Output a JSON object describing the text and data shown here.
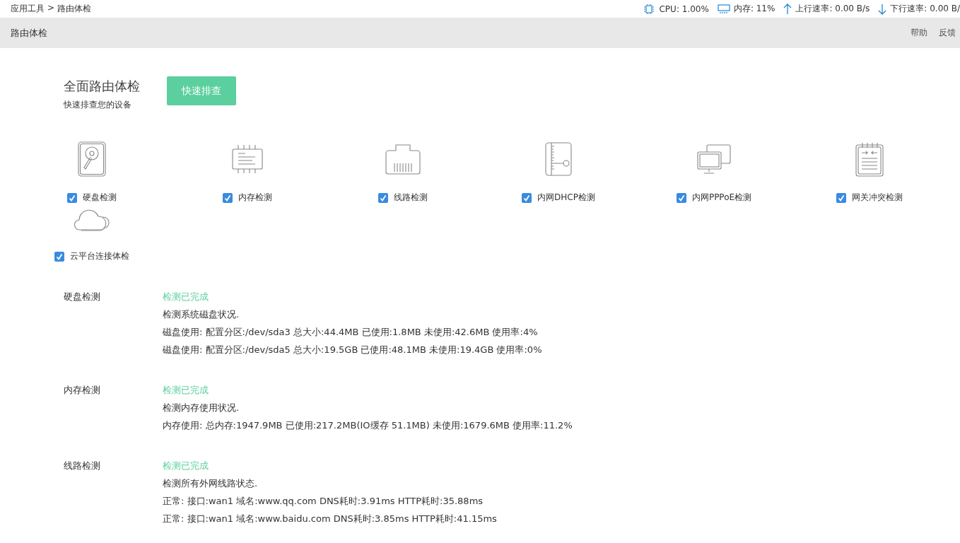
{
  "breadcrumb": [
    "应用工具",
    "路由体检"
  ],
  "breadcrumb_separator": ">",
  "stats": [
    {
      "kind": "cpu",
      "text": "CPU: 1.00%"
    },
    {
      "kind": "memory",
      "text": "内存: 11%"
    },
    {
      "kind": "upload",
      "text": "上行速率: 0.00 B/s"
    },
    {
      "kind": "download",
      "text": "下行速率: 0.00 B/"
    }
  ],
  "page_title": "路由体检",
  "header_links": [
    "帮助",
    "反馈"
  ],
  "intro": {
    "title": "全面路由体检",
    "subtitle": "快速排查您的设备",
    "button": "快速排查"
  },
  "checks": [
    {
      "kind": "disk",
      "label": "硬盘检测",
      "checked": true
    },
    {
      "kind": "memory",
      "label": "内存检测",
      "checked": true
    },
    {
      "kind": "port",
      "label": "线路检测",
      "checked": true
    },
    {
      "kind": "dhcp",
      "label": "内网DHCP检测",
      "checked": true
    },
    {
      "kind": "pppoe",
      "label": "内网PPPoE检测",
      "checked": true
    },
    {
      "kind": "gateway",
      "label": "网关冲突检测",
      "checked": true
    },
    {
      "kind": "cloud",
      "label": "云平台连接体检",
      "checked": true
    }
  ],
  "results": [
    {
      "name": "硬盘检测",
      "status": "检测已完成",
      "lines": [
        "检测系统磁盘状况.",
        "磁盘使用: 配置分区:/dev/sda3 总大小:44.4MB 已使用:1.8MB 未使用:42.6MB 使用率:4%",
        "磁盘使用: 配置分区:/dev/sda5 总大小:19.5GB 已使用:48.1MB 未使用:19.4GB 使用率:0%"
      ]
    },
    {
      "name": "内存检测",
      "status": "检测已完成",
      "lines": [
        "检测内存使用状况.",
        "内存使用: 总内存:1947.9MB 已使用:217.2MB(IO缓存 51.1MB) 未使用:1679.6MB 使用率:11.2%"
      ]
    },
    {
      "name": "线路检测",
      "status": "检测已完成",
      "lines": [
        "检测所有外网线路状态.",
        "正常: 接口:wan1 域名:www.qq.com DNS耗时:3.91ms HTTP耗时:35.88ms",
        "正常: 接口:wan1 域名:www.baidu.com DNS耗时:3.85ms HTTP耗时:41.15ms"
      ]
    }
  ]
}
